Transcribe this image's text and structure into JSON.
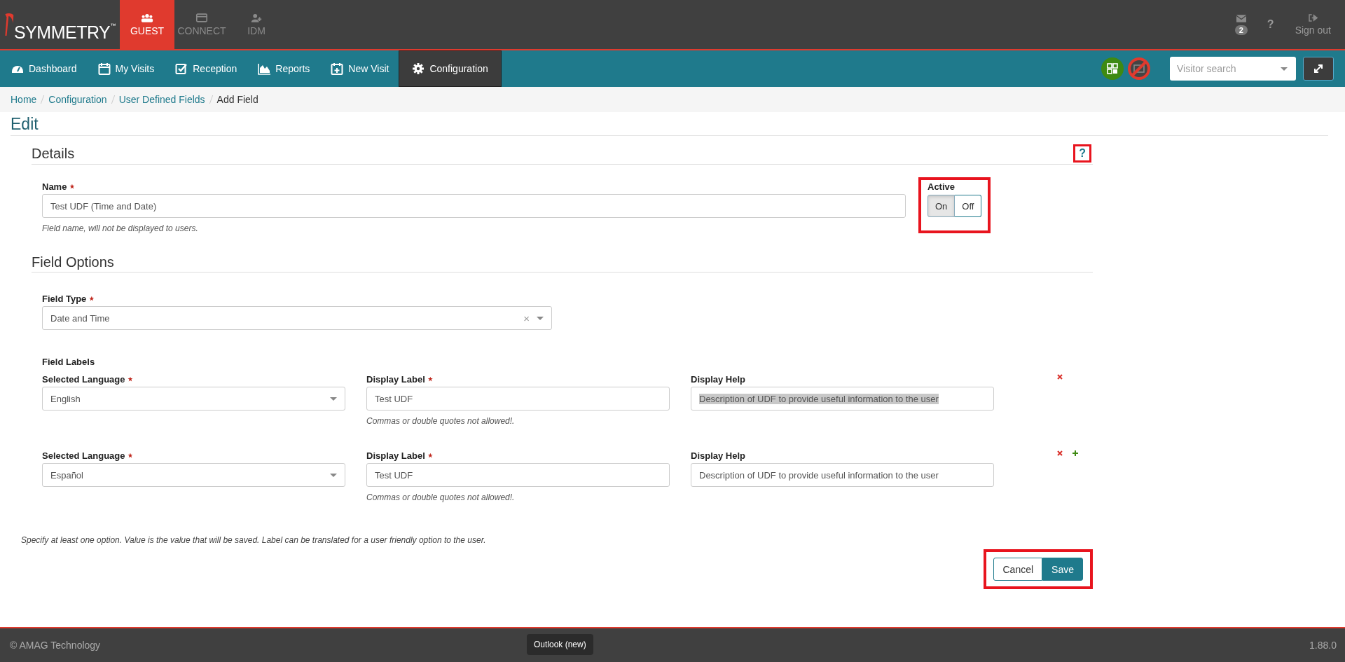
{
  "brand": {
    "name": "SYMMETRY",
    "mark": "™"
  },
  "apps": [
    {
      "label": "GUEST",
      "selected": true
    },
    {
      "label": "CONNECT",
      "selected": false
    },
    {
      "label": "IDM",
      "selected": false
    }
  ],
  "top_right": {
    "mail_count": "2",
    "help": "?",
    "sign_out": "Sign out"
  },
  "nav": [
    {
      "label": "Dashboard",
      "selected": false
    },
    {
      "label": "My Visits",
      "selected": false
    },
    {
      "label": "Reception",
      "selected": false
    },
    {
      "label": "Reports",
      "selected": false
    },
    {
      "label": "New Visit",
      "selected": false
    },
    {
      "label": "Configuration",
      "selected": true
    }
  ],
  "visitor_search": {
    "placeholder": "Visitor search"
  },
  "breadcrumb": [
    "Home",
    "Configuration",
    "User Defined Fields",
    "Add Field"
  ],
  "page_title": "Edit",
  "details": {
    "heading": "Details",
    "help": "?",
    "help_highlighted": true,
    "name": {
      "label": "Name",
      "required": true,
      "value": "Test UDF (Time and Date)",
      "hint": "Field name, will not be displayed to users."
    },
    "active": {
      "label": "Active",
      "highlighted": true,
      "options": [
        {
          "label": "On",
          "selected": true
        },
        {
          "label": "Off",
          "selected": false
        }
      ]
    }
  },
  "field_options": {
    "heading": "Field Options",
    "field_type": {
      "label": "Field Type",
      "required": true,
      "value": "Date and Time",
      "clear": "×"
    },
    "labels_heading": "Field Labels",
    "rows": [
      {
        "language_label": "Selected Language",
        "language": "English",
        "display_label_label": "Display Label",
        "display_label": "Test UDF",
        "hint": "Commas or double quotes not allowed!.",
        "display_help_label": "Display Help",
        "display_help": "Description of UDF to provide useful information to the user",
        "help_selected": true,
        "can_add": false
      },
      {
        "language_label": "Selected Language",
        "language": "Español",
        "display_label_label": "Display Label",
        "display_label": "Test UDF",
        "hint": "Commas or double quotes not allowed!.",
        "display_help_label": "Display Help",
        "display_help": "Description of UDF to provide useful information to the user",
        "help_selected": false,
        "can_add": true
      }
    ],
    "note": "Specify at least one option. Value is the value that will be saved. Label can be translated for a user friendly option to the user."
  },
  "actions": {
    "highlighted": true,
    "buttons": [
      {
        "label": "Cancel",
        "kind": "secondary"
      },
      {
        "label": "Save",
        "kind": "primary"
      }
    ]
  },
  "footer": {
    "copyright": "© AMAG Technology",
    "version": "1.88.0"
  },
  "tooltip": "Outlook (new)"
}
